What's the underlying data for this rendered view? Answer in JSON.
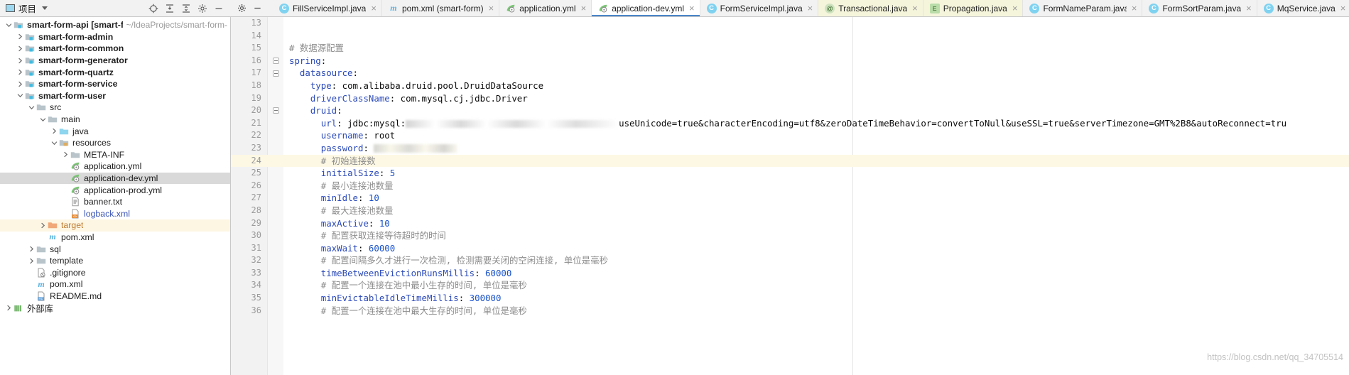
{
  "project_panel": {
    "title": "项目",
    "icons": [
      "locate-icon",
      "collapse-all-icon",
      "expand-all-icon",
      "settings-icon",
      "hide-icon"
    ],
    "tree": [
      {
        "label": "smart-form-api [smart-form]",
        "path": "~/IdeaProjects/smart-form-",
        "depth": 0,
        "arrow": "down",
        "icon": "module-folder-icon",
        "bold": true
      },
      {
        "label": "smart-form-admin",
        "depth": 1,
        "arrow": "right",
        "icon": "module-folder-icon",
        "bold": true
      },
      {
        "label": "smart-form-common",
        "depth": 1,
        "arrow": "right",
        "icon": "module-folder-icon",
        "bold": true
      },
      {
        "label": "smart-form-generator",
        "depth": 1,
        "arrow": "right",
        "icon": "module-folder-icon",
        "bold": true
      },
      {
        "label": "smart-form-quartz",
        "depth": 1,
        "arrow": "right",
        "icon": "module-folder-icon",
        "bold": true
      },
      {
        "label": "smart-form-service",
        "depth": 1,
        "arrow": "right",
        "icon": "module-folder-icon",
        "bold": true
      },
      {
        "label": "smart-form-user",
        "depth": 1,
        "arrow": "down",
        "icon": "module-folder-icon",
        "bold": true
      },
      {
        "label": "src",
        "depth": 2,
        "arrow": "down",
        "icon": "folder-icon"
      },
      {
        "label": "main",
        "depth": 3,
        "arrow": "down",
        "icon": "folder-icon"
      },
      {
        "label": "java",
        "depth": 4,
        "arrow": "right",
        "icon": "source-folder-icon"
      },
      {
        "label": "resources",
        "depth": 4,
        "arrow": "down",
        "icon": "resources-folder-icon"
      },
      {
        "label": "META-INF",
        "depth": 5,
        "arrow": "right",
        "icon": "folder-icon"
      },
      {
        "label": "application.yml",
        "depth": 5,
        "arrow": "none",
        "icon": "yaml-file-icon"
      },
      {
        "label": "application-dev.yml",
        "depth": 5,
        "arrow": "none",
        "icon": "yaml-file-icon",
        "selected": true
      },
      {
        "label": "application-prod.yml",
        "depth": 5,
        "arrow": "none",
        "icon": "yaml-file-icon"
      },
      {
        "label": "banner.txt",
        "depth": 5,
        "arrow": "none",
        "icon": "text-file-icon"
      },
      {
        "label": "logback.xml",
        "depth": 5,
        "arrow": "none",
        "icon": "xml-file-icon",
        "link": true
      },
      {
        "label": "target",
        "depth": 3,
        "arrow": "right",
        "icon": "excluded-folder-icon",
        "orange": true,
        "highlight": true
      },
      {
        "label": "pom.xml",
        "depth": 3,
        "arrow": "none",
        "icon": "maven-file-icon"
      },
      {
        "label": "sql",
        "depth": 2,
        "arrow": "right",
        "icon": "folder-icon"
      },
      {
        "label": "template",
        "depth": 2,
        "arrow": "right",
        "icon": "folder-icon"
      },
      {
        "label": ".gitignore",
        "depth": 2,
        "arrow": "none",
        "icon": "gitignore-file-icon"
      },
      {
        "label": "pom.xml",
        "depth": 2,
        "arrow": "none",
        "icon": "maven-file-icon"
      },
      {
        "label": "README.md",
        "depth": 2,
        "arrow": "none",
        "icon": "markdown-file-icon"
      },
      {
        "label": "外部库",
        "depth": 0,
        "arrow": "right",
        "icon": "library-icon"
      }
    ]
  },
  "editor_tabs": [
    {
      "label": "FillServiceImpl.java",
      "icon": "java-class-icon",
      "state": "normal"
    },
    {
      "label": "pom.xml (smart-form)",
      "icon": "maven-file-icon",
      "state": "normal"
    },
    {
      "label": "application.yml",
      "icon": "yaml-file-icon",
      "state": "normal"
    },
    {
      "label": "application-dev.yml",
      "icon": "yaml-file-icon",
      "state": "active"
    },
    {
      "label": "FormServiceImpl.java",
      "icon": "java-class-icon",
      "state": "normal"
    },
    {
      "label": "Transactional.java",
      "icon": "java-annotation-icon",
      "state": "tinted"
    },
    {
      "label": "Propagation.java",
      "icon": "java-enum-icon",
      "state": "tinted"
    },
    {
      "label": "FormNameParam.java",
      "icon": "java-class-icon",
      "state": "normal"
    },
    {
      "label": "FormSortParam.java",
      "icon": "java-class-icon",
      "state": "normal"
    },
    {
      "label": "MqService.java",
      "icon": "java-class-icon",
      "state": "normal"
    }
  ],
  "tab_close_label": "×",
  "code": {
    "first_line_number": 13,
    "caret_line_number": 24,
    "lines": [
      {
        "num": 13,
        "tokens": []
      },
      {
        "num": 14,
        "tokens": []
      },
      {
        "num": 15,
        "tokens": [
          {
            "t": "comment",
            "s": "# 数据源配置"
          }
        ]
      },
      {
        "num": 16,
        "fold": "open",
        "tokens": [
          {
            "t": "key",
            "s": "spring"
          },
          {
            "t": "plain",
            "s": ":"
          }
        ]
      },
      {
        "num": 17,
        "fold": "open",
        "indent": 2,
        "tokens": [
          {
            "t": "key",
            "s": "datasource"
          },
          {
            "t": "plain",
            "s": ":"
          }
        ]
      },
      {
        "num": 18,
        "indent": 4,
        "tokens": [
          {
            "t": "key",
            "s": "type"
          },
          {
            "t": "plain",
            "s": ": com.alibaba.druid.pool.DruidDataSource"
          }
        ]
      },
      {
        "num": 19,
        "indent": 4,
        "tokens": [
          {
            "t": "key",
            "s": "driverClassName"
          },
          {
            "t": "plain",
            "s": ": com.mysql.cj.jdbc.Driver"
          }
        ]
      },
      {
        "num": 20,
        "fold": "open",
        "indent": 4,
        "tokens": [
          {
            "t": "key",
            "s": "druid"
          },
          {
            "t": "plain",
            "s": ":"
          }
        ]
      },
      {
        "num": 21,
        "indent": 6,
        "tokens": [
          {
            "t": "key",
            "s": "url"
          },
          {
            "t": "plain",
            "s": ": jdbc:mysql:"
          },
          {
            "t": "blur-url",
            "s": ""
          },
          {
            "t": "plain",
            "s": "useUnicode=true&characterEncoding=utf8&zeroDateTimeBehavior=convertToNull&useSSL=true&serverTimezone=GMT%2B8&autoReconnect=tru"
          }
        ]
      },
      {
        "num": 22,
        "indent": 6,
        "tokens": [
          {
            "t": "key",
            "s": "username"
          },
          {
            "t": "plain",
            "s": ": root"
          }
        ]
      },
      {
        "num": 23,
        "indent": 6,
        "tokens": [
          {
            "t": "key",
            "s": "password"
          },
          {
            "t": "plain",
            "s": ": "
          },
          {
            "t": "blur-pw",
            "s": ""
          }
        ]
      },
      {
        "num": 24,
        "indent": 6,
        "caret": true,
        "tokens": [
          {
            "t": "comment",
            "s": "# 初始连接数"
          }
        ]
      },
      {
        "num": 25,
        "indent": 6,
        "tokens": [
          {
            "t": "key",
            "s": "initialSize"
          },
          {
            "t": "plain",
            "s": ": "
          },
          {
            "t": "num",
            "s": "5"
          }
        ]
      },
      {
        "num": 26,
        "indent": 6,
        "tokens": [
          {
            "t": "comment",
            "s": "# 最小连接池数量"
          }
        ]
      },
      {
        "num": 27,
        "indent": 6,
        "tokens": [
          {
            "t": "key",
            "s": "minIdle"
          },
          {
            "t": "plain",
            "s": ": "
          },
          {
            "t": "num",
            "s": "10"
          }
        ]
      },
      {
        "num": 28,
        "indent": 6,
        "tokens": [
          {
            "t": "comment",
            "s": "# 最大连接池数量"
          }
        ]
      },
      {
        "num": 29,
        "indent": 6,
        "tokens": [
          {
            "t": "key",
            "s": "maxActive"
          },
          {
            "t": "plain",
            "s": ": "
          },
          {
            "t": "num",
            "s": "10"
          }
        ]
      },
      {
        "num": 30,
        "indent": 6,
        "tokens": [
          {
            "t": "comment",
            "s": "# 配置获取连接等待超时的时间"
          }
        ]
      },
      {
        "num": 31,
        "indent": 6,
        "tokens": [
          {
            "t": "key",
            "s": "maxWait"
          },
          {
            "t": "plain",
            "s": ": "
          },
          {
            "t": "num",
            "s": "60000"
          }
        ]
      },
      {
        "num": 32,
        "indent": 6,
        "tokens": [
          {
            "t": "comment",
            "s": "# 配置间隔多久才进行一次检测, 检测需要关闭的空闲连接, 单位是毫秒"
          }
        ]
      },
      {
        "num": 33,
        "indent": 6,
        "tokens": [
          {
            "t": "key",
            "s": "timeBetweenEvictionRunsMillis"
          },
          {
            "t": "plain",
            "s": ": "
          },
          {
            "t": "num",
            "s": "60000"
          }
        ]
      },
      {
        "num": 34,
        "indent": 6,
        "tokens": [
          {
            "t": "comment",
            "s": "# 配置一个连接在池中最小生存的时间, 单位是毫秒"
          }
        ]
      },
      {
        "num": 35,
        "indent": 6,
        "tokens": [
          {
            "t": "key",
            "s": "minEvictableIdleTimeMillis"
          },
          {
            "t": "plain",
            "s": ": "
          },
          {
            "t": "num",
            "s": "300000"
          }
        ]
      },
      {
        "num": 36,
        "indent": 6,
        "tokens": [
          {
            "t": "comment",
            "s": "# 配置一个连接在池中最大生存的时间, 单位是毫秒"
          }
        ]
      }
    ]
  },
  "watermark": "https://blog.csdn.net/qq_34705514",
  "colors": {
    "accent": "#4a86c8",
    "key": "#2a49b8",
    "number": "#1750c8",
    "comment": "#8c8c8c",
    "selection": "#d9d9d9",
    "caret_line": "#fdf8e4"
  }
}
